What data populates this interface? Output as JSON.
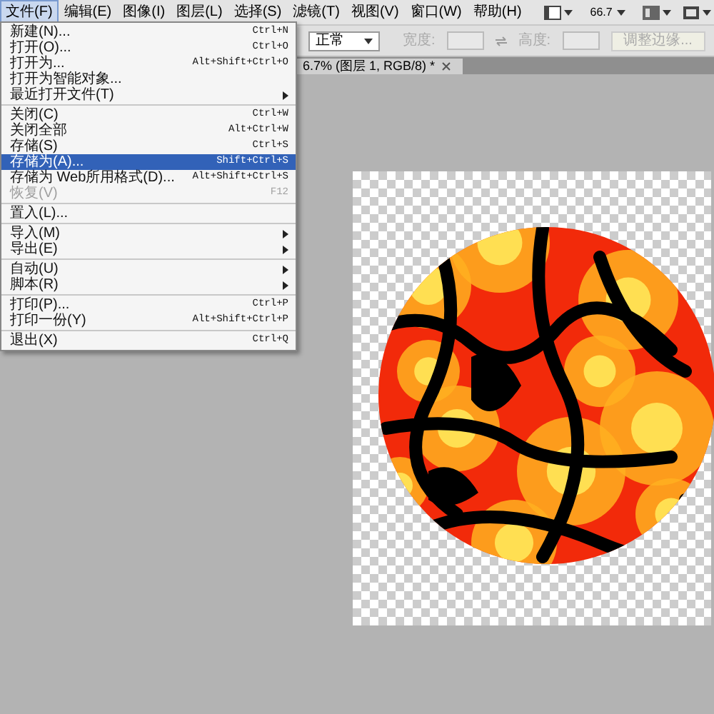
{
  "menu_bar": {
    "items": [
      {
        "label": "文件(F)",
        "selected": true
      },
      {
        "label": "编辑(E)",
        "selected": false
      },
      {
        "label": "图像(I)",
        "selected": false
      },
      {
        "label": "图层(L)",
        "selected": false
      },
      {
        "label": "选择(S)",
        "selected": false
      },
      {
        "label": "滤镜(T)",
        "selected": false
      },
      {
        "label": "视图(V)",
        "selected": false
      },
      {
        "label": "窗口(W)",
        "selected": false
      },
      {
        "label": "帮助(H)",
        "selected": false
      }
    ],
    "zoom": "66.7"
  },
  "options_bar": {
    "mode": "正常",
    "width_label": "宽度:",
    "height_label": "高度:",
    "refine_button": "调整边缘..."
  },
  "document_tab": {
    "title": "6.7% (图层 1, RGB/8) *"
  },
  "file_menu": {
    "groups": [
      [
        {
          "label": "新建(N)...",
          "shortcut": "Ctrl+N",
          "submenu": false,
          "disabled": false,
          "selected": false
        },
        {
          "label": "打开(O)...",
          "shortcut": "Ctrl+O",
          "submenu": false,
          "disabled": false,
          "selected": false
        },
        {
          "label": "打开为...",
          "shortcut": "Alt+Shift+Ctrl+O",
          "submenu": false,
          "disabled": false,
          "selected": false
        },
        {
          "label": "打开为智能对象...",
          "submenu": false,
          "disabled": false,
          "selected": false
        },
        {
          "label": "最近打开文件(T)",
          "submenu": true,
          "disabled": false,
          "selected": false
        }
      ],
      [
        {
          "label": "关闭(C)",
          "shortcut": "Ctrl+W",
          "submenu": false,
          "disabled": false,
          "selected": false
        },
        {
          "label": "关闭全部",
          "shortcut": "Alt+Ctrl+W",
          "submenu": false,
          "disabled": false,
          "selected": false
        },
        {
          "label": "存储(S)",
          "shortcut": "Ctrl+S",
          "submenu": false,
          "disabled": false,
          "selected": false
        },
        {
          "label": "存储为(A)...",
          "shortcut": "Shift+Ctrl+S",
          "submenu": false,
          "disabled": false,
          "selected": true
        },
        {
          "label": "存储为 Web所用格式(D)...",
          "shortcut": "Alt+Shift+Ctrl+S",
          "submenu": false,
          "disabled": false,
          "selected": false
        },
        {
          "label": "恢复(V)",
          "shortcut": "F12",
          "submenu": false,
          "disabled": true,
          "selected": false
        }
      ],
      [
        {
          "label": "置入(L)...",
          "submenu": false,
          "disabled": false,
          "selected": false
        }
      ],
      [
        {
          "label": "导入(M)",
          "submenu": true,
          "disabled": false,
          "selected": false
        },
        {
          "label": "导出(E)",
          "submenu": true,
          "disabled": false,
          "selected": false
        }
      ],
      [
        {
          "label": "自动(U)",
          "submenu": true,
          "disabled": false,
          "selected": false
        },
        {
          "label": "脚本(R)",
          "submenu": true,
          "disabled": false,
          "selected": false
        }
      ],
      [
        {
          "label": "打印(P)...",
          "shortcut": "Ctrl+P",
          "submenu": false,
          "disabled": false,
          "selected": false
        },
        {
          "label": "打印一份(Y)",
          "shortcut": "Alt+Shift+Ctrl+P",
          "submenu": false,
          "disabled": false,
          "selected": false
        }
      ],
      [
        {
          "label": "退出(X)",
          "shortcut": "Ctrl+Q",
          "submenu": false,
          "disabled": false,
          "selected": false
        }
      ]
    ]
  }
}
